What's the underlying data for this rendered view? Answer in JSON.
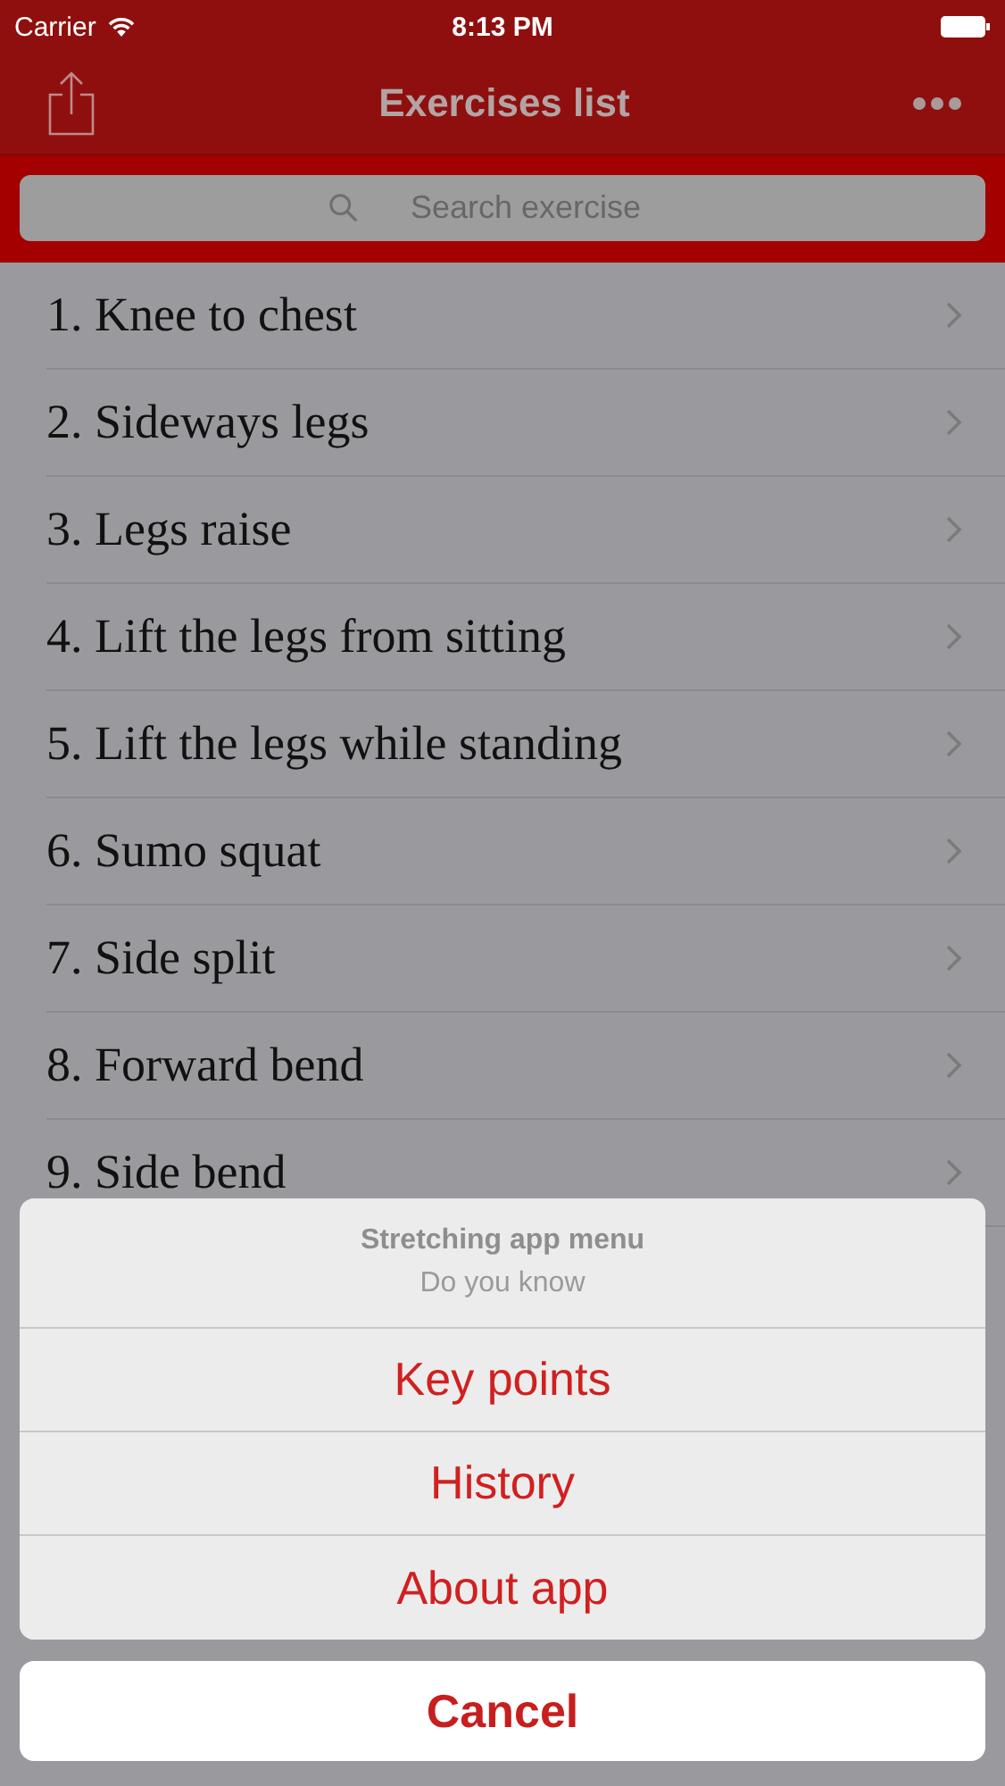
{
  "status_bar": {
    "carrier": "Carrier",
    "time": "8:13 PM"
  },
  "nav_bar": {
    "title": "Exercises list"
  },
  "search": {
    "placeholder": "Search exercise"
  },
  "exercises": [
    {
      "label": "1. Knee to chest"
    },
    {
      "label": "2. Sideways legs"
    },
    {
      "label": "3. Legs raise"
    },
    {
      "label": "4. Lift the legs from sitting"
    },
    {
      "label": "5. Lift the legs while standing"
    },
    {
      "label": "6. Sumo squat"
    },
    {
      "label": "7. Side split"
    },
    {
      "label": "8. Forward bend"
    },
    {
      "label": "9. Side bend"
    }
  ],
  "action_sheet": {
    "title": "Stretching app menu",
    "message": "Do you know",
    "items": [
      "Key points",
      "History",
      "About app"
    ],
    "cancel": "Cancel"
  }
}
